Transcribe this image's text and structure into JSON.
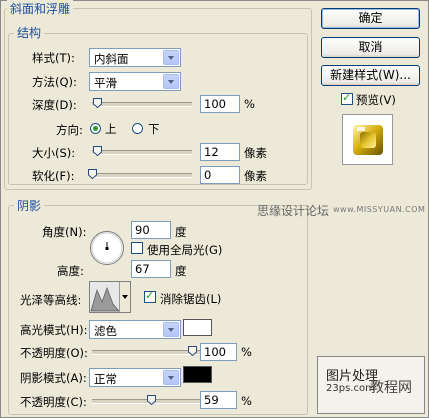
{
  "bevel": {
    "title": "斜面和浮雕",
    "structure_title": "结构",
    "style_label": "样式(T):",
    "style_value": "内斜面",
    "technique_label": "方法(Q):",
    "technique_value": "平滑",
    "depth_label": "深度(D):",
    "depth_value": "100",
    "depth_unit": "%",
    "depth_level": 0.05,
    "direction_label": "方向:",
    "direction_up": "上",
    "direction_down": "下",
    "size_label": "大小(S):",
    "size_value": "12",
    "size_unit": "像素",
    "size_level": 0.05,
    "soften_label": "软化(F):",
    "soften_value": "0",
    "soften_unit": "像素",
    "soften_level": 0
  },
  "shading": {
    "title": "阴影",
    "angle_label": "角度(N):",
    "angle_value": "90",
    "angle_unit": "度",
    "global_light_label": "使用全局光(G)",
    "global_light_checked": false,
    "altitude_label": "高度:",
    "altitude_value": "67",
    "altitude_unit": "度",
    "gloss_contour_label": "光泽等高线:",
    "anti_aliased_label": "消除锯齿(L)",
    "anti_aliased_checked": true,
    "highlight_mode_label": "高光模式(H):",
    "highlight_mode_value": "滤色",
    "highlight_color": "#ffffff",
    "highlight_opacity_label": "不透明度(O):",
    "highlight_opacity_value": "100",
    "highlight_opacity_unit": "%",
    "highlight_opacity_level": 1.0,
    "shadow_mode_label": "阴影模式(A):",
    "shadow_mode_value": "正常",
    "shadow_color": "#000000",
    "shadow_opacity_label": "不透明度(C):",
    "shadow_opacity_value": "59",
    "shadow_opacity_unit": "%",
    "shadow_opacity_level": 0.59
  },
  "buttons": {
    "ok": "确定",
    "cancel": "取消",
    "new_style": "新建样式(W)...",
    "preview_label": "预览(V)",
    "preview_checked": true
  },
  "watermarks": {
    "forum": "思缘设计论坛",
    "site": "www.MISSYUAN.COM",
    "stamp_line1": "图片处理",
    "stamp_line2": "23ps.com",
    "stamp_line3": "教程网"
  },
  "colors": {
    "group_title": "#1f4fa1",
    "radio_dot": "#21a121",
    "button_border": "#003c74"
  }
}
